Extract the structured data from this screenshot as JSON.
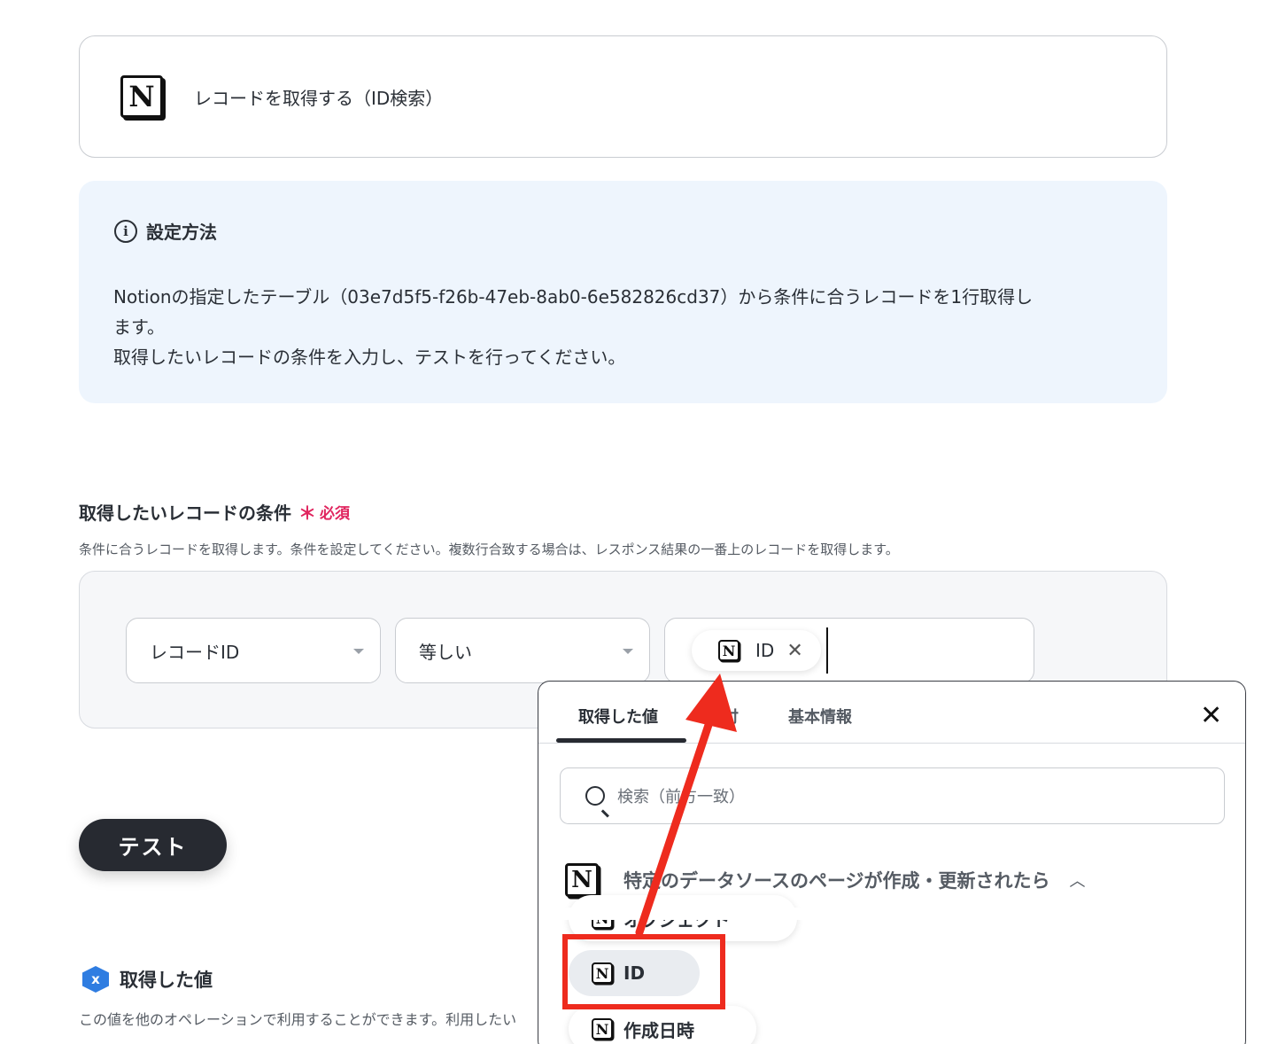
{
  "app_card": {
    "logo": "N",
    "title": "レコードを取得する（ID検索）"
  },
  "info": {
    "icon_glyph": "i",
    "heading": "設定方法",
    "line1": "Notionの指定したテーブル（03e7d5f5-f26b-47eb-8ab0-6e582826cd37）から条件に合うレコードを1行取得し",
    "line2": "ます。",
    "line3": "取得したいレコードの条件を入力し、テストを行ってください。"
  },
  "condition": {
    "label": "取得したいレコードの条件",
    "required_mark": "＊",
    "required_text": "必須",
    "description": "条件に合うレコードを取得します。条件を設定してください。複数行合致する場合は、レスポンス結果の一番上のレコードを取得します。",
    "field_select": "レコードID",
    "operator_select": "等しい",
    "chip": {
      "logo": "N",
      "label": "ID",
      "close_glyph": "✕"
    }
  },
  "test_button": "テスト",
  "obtained": {
    "icon_glyph": "x",
    "heading": "取得した値",
    "description": "この値を他のオペレーションで利用することができます。利用したい"
  },
  "popup": {
    "tabs": [
      "取得した値",
      "日付",
      "基本情報"
    ],
    "active_tab": 0,
    "close_glyph": "✕",
    "search_placeholder": "検索（前方一致）",
    "source": {
      "logo": "N",
      "label": "特定のデータソースのページが作成・更新されたら",
      "chevron": "︿"
    },
    "items": [
      {
        "logo": "N",
        "label": "オブジェクト"
      },
      {
        "logo": "N",
        "label": "ID"
      },
      {
        "logo": "N",
        "label": "作成日時"
      }
    ]
  },
  "annotation_color": "#ee2b1e"
}
